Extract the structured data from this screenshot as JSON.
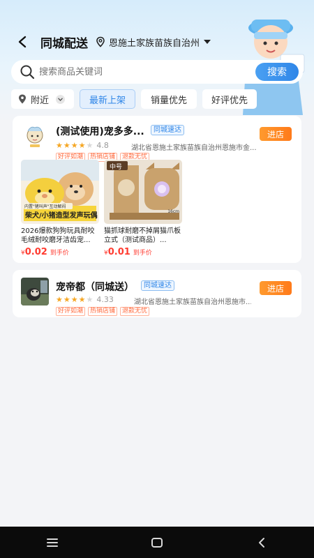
{
  "header": {
    "title": "同城配送",
    "location": "恩施土家族苗族自治州"
  },
  "search": {
    "placeholder": "搜索商品关键词",
    "button": "搜索"
  },
  "filters": {
    "nearby": "附近",
    "newest": "最新上架",
    "sales": "销量优先",
    "rating": "好评优先"
  },
  "stores": [
    {
      "name": "(测试使用)宠多多...",
      "badge": "同城速达",
      "rating": "4.8",
      "address": "湖北省恩施土家族苗族自治州恩施市金...",
      "tags": [
        "好评如潮",
        "热销店铺",
        "退款无忧"
      ],
      "enter": "进店",
      "products": [
        {
          "name": "2026爆款狗狗玩具耐咬毛绒耐咬磨牙洁齿宠...",
          "yen": "¥",
          "price": "0.02",
          "label": "到手价",
          "img_text": [
            "柴犬/小猪造型发声玩偶",
            "内置\"猪叫声\"互动解闷"
          ]
        },
        {
          "name": "猫抓球耐磨不掉屑猫爪板立式（测试商品）...",
          "yen": "¥",
          "price": "0.01",
          "label": "到手价",
          "img_text": [
            "中号",
            "16cm"
          ]
        }
      ]
    },
    {
      "name": "宠帝都（同城送）",
      "badge": "同城速达",
      "rating": "4.33",
      "address": "湖北省恩施土家族苗族自治州恩施市...",
      "tags": [
        "好评如潮",
        "热销店铺",
        "退款无忧"
      ],
      "enter": "进店"
    }
  ],
  "colors": {
    "accent": "#2f86e8",
    "orange": "#ff7a1a",
    "price": "#ff3b30",
    "star": "#f5a623"
  },
  "icons": {
    "back": "chevron-left-icon",
    "location": "pin-icon",
    "search": "search-icon",
    "nav": [
      "menu-icon",
      "home-square-icon",
      "back-triangle-icon"
    ]
  }
}
